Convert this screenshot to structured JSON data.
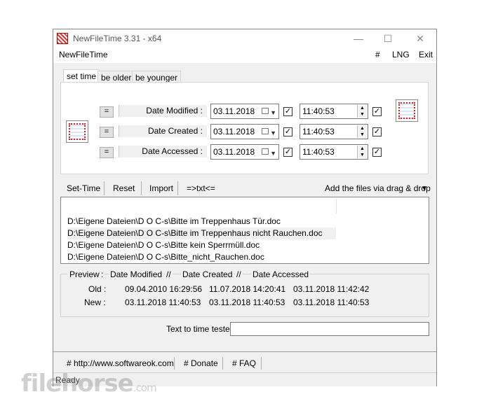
{
  "window": {
    "title": "NewFileTime 3.31 - x64",
    "controls": {
      "minimize": "—",
      "maximize": "☐",
      "close": "✕"
    }
  },
  "menu": {
    "app_name": "NewFileTime",
    "hash": "#",
    "lng": "LNG",
    "exit": "Exit"
  },
  "tabs": [
    {
      "label": "set time",
      "active": true
    },
    {
      "label": "be older",
      "active": false
    },
    {
      "label": "be younger",
      "active": false
    }
  ],
  "rows": [
    {
      "eq": "=",
      "label": "Date Modified :",
      "date": "03.11.2018",
      "time": "11:40:53",
      "date_checked": true,
      "time_checked": true
    },
    {
      "eq": "=",
      "label": "Date Created :",
      "date": "03.11.2018",
      "time": "11:40:53",
      "date_checked": true,
      "time_checked": true
    },
    {
      "eq": "=",
      "label": "Date Accessed :",
      "date": "03.11.2018",
      "time": "11:40:53",
      "date_checked": true,
      "time_checked": true
    }
  ],
  "toolbar": {
    "set_time": "Set-Time",
    "reset": "Reset",
    "import": "Import",
    "txt": "=>txt<=",
    "drag_drop": "Add the files via drag & drop",
    "drag_drop_arrow": "▼"
  },
  "files": [
    {
      "path": "D:\\Eigene Dateien\\D O C-s\\Bitte im Treppenhaus Tür.doc",
      "selected": false
    },
    {
      "path": "D:\\Eigene Dateien\\D O C-s\\Bitte im Treppenhaus nicht Rauchen.doc",
      "selected": true
    },
    {
      "path": "D:\\Eigene Dateien\\D O C-s\\Bitte kein Sperrmüll.doc",
      "selected": false
    },
    {
      "path": "D:\\Eigene Dateien\\D O C-s\\Bitte_nicht_Rauchen.doc",
      "selected": false
    }
  ],
  "preview": {
    "header": {
      "preview": "Preview",
      "colon": ":",
      "modified": "Date Modified",
      "sep1": "//",
      "created": "Date Created",
      "sep2": "//",
      "accessed": "Date Accessed"
    },
    "old": {
      "label": "Old :",
      "modified": "09.04.2010 16:29:56",
      "created": "11.07.2018 14:20:41",
      "accessed": "03.11.2018 11:42:42"
    },
    "new": {
      "label": "New :",
      "modified": "03.11.2018 11:40:53",
      "created": "03.11.2018 11:40:53",
      "accessed": "03.11.2018 11:40:53"
    }
  },
  "tester": {
    "label": "Text to time tester",
    "value": ""
  },
  "links": {
    "website": "# http://www.softwareok.com",
    "donate": "# Donate",
    "faq": "# FAQ"
  },
  "status": {
    "text": "Ready"
  },
  "watermark": {
    "brand": "filehorse",
    "domain": ".com"
  }
}
